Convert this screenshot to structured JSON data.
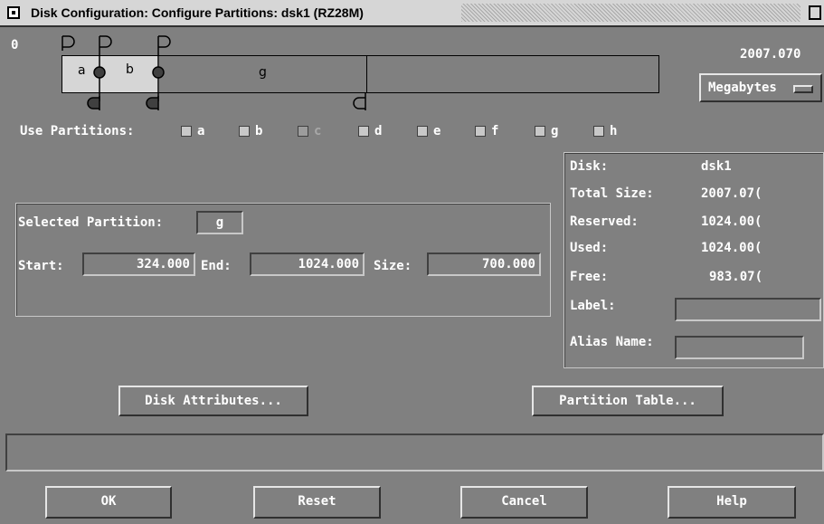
{
  "window": {
    "title": "Disk Configuration: Configure Partitions: dsk1 (RZ28M)"
  },
  "map": {
    "start_label": "0",
    "end_label": "2007.070",
    "units_selected": "Megabytes",
    "segments": [
      "a",
      "b",
      "g"
    ]
  },
  "use_partitions": {
    "label": "Use Partitions:",
    "items": [
      {
        "label": "a",
        "enabled": true
      },
      {
        "label": "b",
        "enabled": true
      },
      {
        "label": "c",
        "enabled": false
      },
      {
        "label": "d",
        "enabled": true
      },
      {
        "label": "e",
        "enabled": true
      },
      {
        "label": "f",
        "enabled": true
      },
      {
        "label": "g",
        "enabled": true
      },
      {
        "label": "h",
        "enabled": true
      }
    ]
  },
  "selected": {
    "label": "Selected Partition:",
    "value": "g",
    "start_label": "Start:",
    "start": "324.000",
    "end_label": "End:",
    "end": "1024.000",
    "size_label": "Size:",
    "size": "700.000"
  },
  "info": {
    "disk_label": "Disk:",
    "disk": "dsk1",
    "total_label": "Total Size:",
    "total": "2007.07(",
    "reserved_label": "Reserved:",
    "reserved": "1024.00(",
    "used_label": "Used:",
    "used": "1024.00(",
    "free_label": "Free:",
    "free": "983.07(",
    "label_label": "Label:",
    "label_value": "",
    "alias_label": "Alias Name:",
    "alias_value": ""
  },
  "buttons": {
    "disk_attributes": "Disk Attributes...",
    "partition_table": "Partition Table...",
    "ok": "OK",
    "reset": "Reset",
    "cancel": "Cancel",
    "help": "Help"
  },
  "status": {
    "text": ""
  }
}
